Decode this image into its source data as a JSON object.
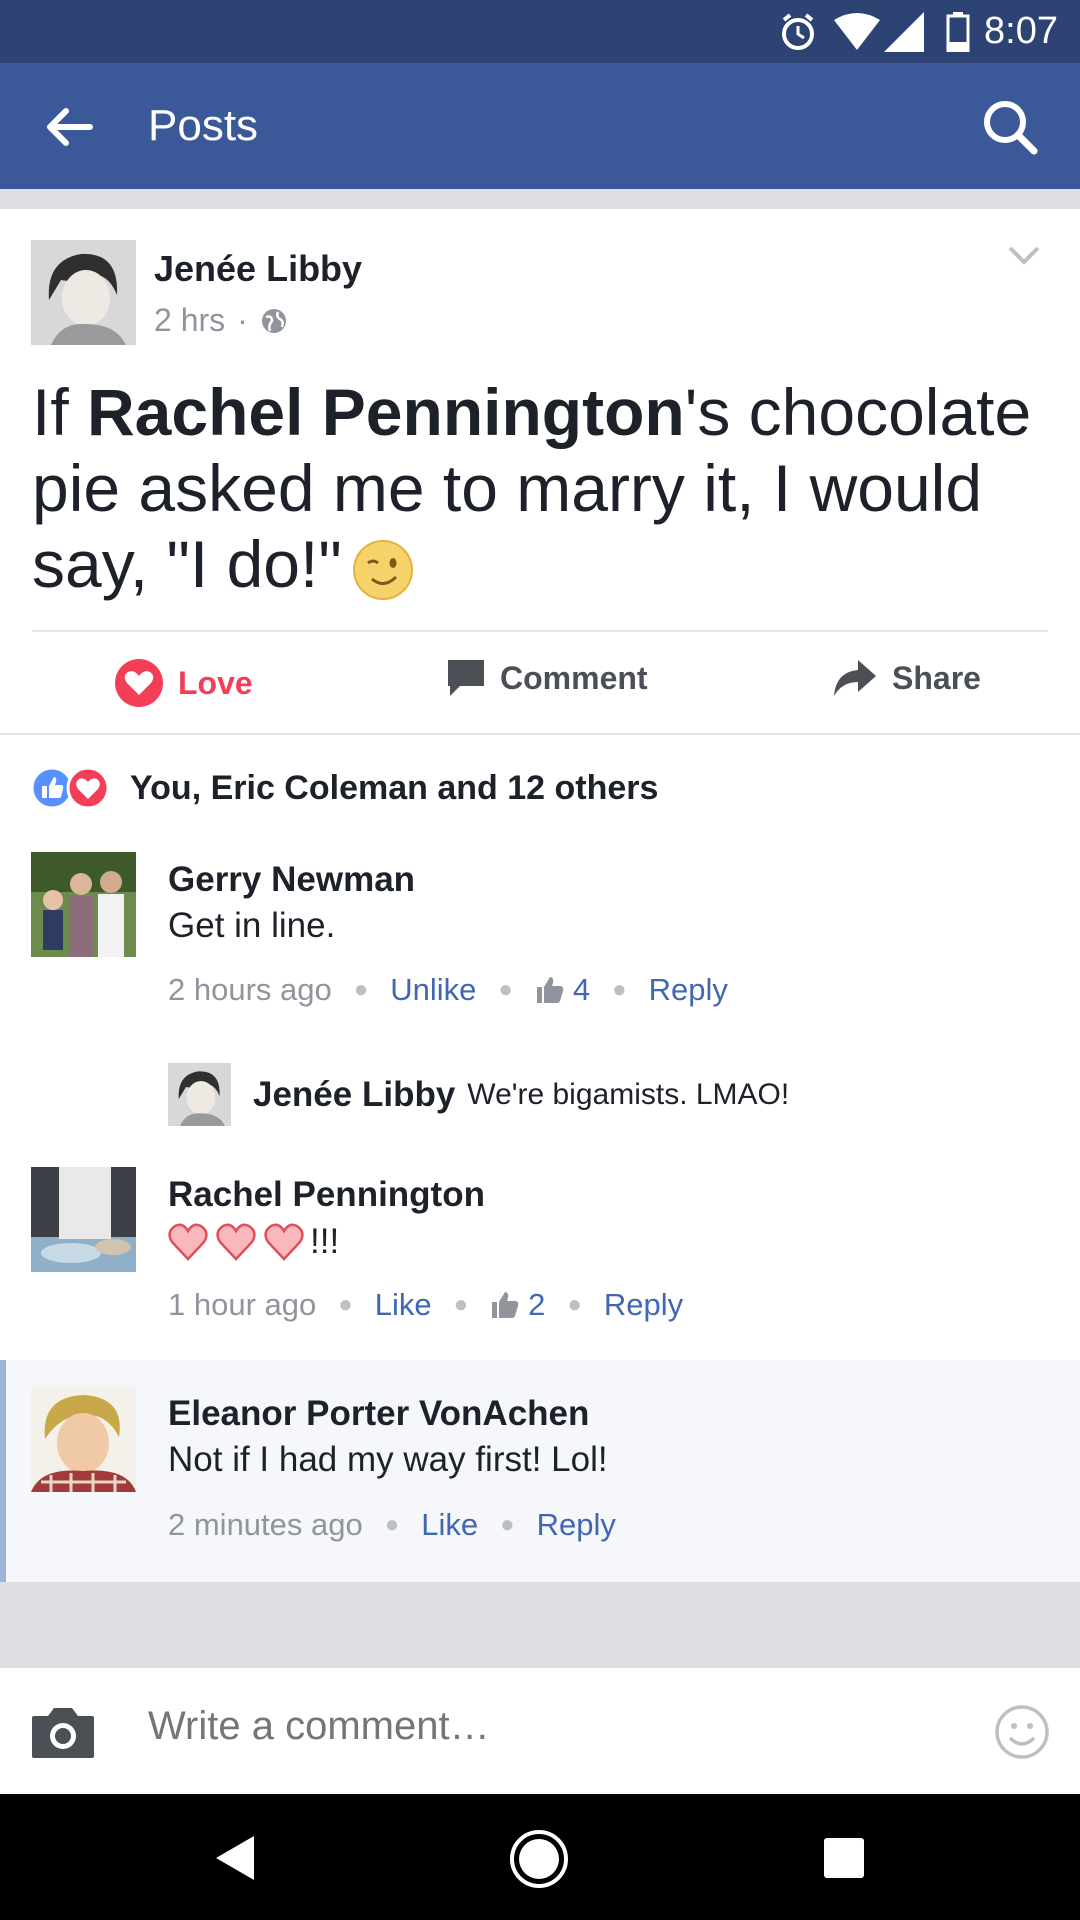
{
  "status_bar": {
    "time": "8:07"
  },
  "app_bar": {
    "title": "Posts"
  },
  "post": {
    "author": "Jenée Libby",
    "time": "2 hrs",
    "text_before": "If ",
    "mention": "Rachel Pennington",
    "text_after": "'s chocolate pie asked me to marry it, I would say, \"I do!\"",
    "actions": {
      "love": "Love",
      "comment": "Comment",
      "share": "Share"
    }
  },
  "reactions": {
    "summary": "You, Eric Coleman and 12 others"
  },
  "comments": [
    {
      "name": "Gerry Newman",
      "text": "Get in line.",
      "time": "2 hours ago",
      "like_label": "Unlike",
      "likes": "4",
      "reply_label": "Reply",
      "reply": {
        "name": "Jenée Libby",
        "text": "We're bigamists. LMAO!"
      }
    },
    {
      "name": "Rachel Pennington",
      "text": "!!!",
      "time": "1 hour ago",
      "like_label": "Like",
      "likes": "2",
      "reply_label": "Reply"
    },
    {
      "name": "Eleanor Porter VonAchen",
      "text": "Not if I had my way first!  Lol!",
      "time": "2 minutes ago",
      "like_label": "Like",
      "reply_label": "Reply"
    }
  ],
  "composer": {
    "placeholder": "Write a comment…"
  },
  "colors": {
    "brand": "#3b5998",
    "love": "#f33e58",
    "link": "#4267b2"
  }
}
